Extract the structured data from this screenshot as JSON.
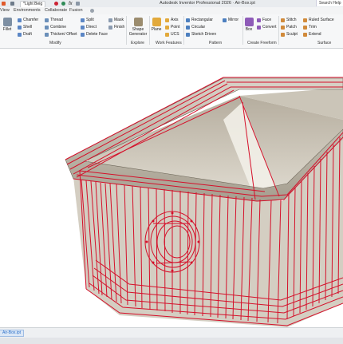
{
  "app": {
    "title": "Autodesk Inventor Professional 2026 · Air-Box.ipt",
    "search_label": "Search Help"
  },
  "quick_access": {
    "document_style": "*Light Beig",
    "fx_label": "fx"
  },
  "menu": {
    "tabs": [
      "View",
      "Environments",
      "Collaborate",
      "Fusion"
    ]
  },
  "ribbon": {
    "modify": {
      "label": "Modify",
      "fillet": "Fillet",
      "chamfer": "Chamfer",
      "shell": "Shell",
      "draft": "Draft",
      "thread": "Thread",
      "combine": "Combine",
      "thicken": "Thicken/ Offset",
      "split": "Split",
      "direct": "Direct",
      "delete_face": "Delete Face",
      "mask": "Mask",
      "finish": "Finish"
    },
    "explore": {
      "label": "Explore",
      "shape_generator": "Shape Generator"
    },
    "work_features": {
      "label": "Work Features",
      "plane": "Plane",
      "axis": "Axis",
      "point": "Point",
      "ucs": "UCS"
    },
    "pattern": {
      "label": "Pattern",
      "rectangular": "Rectangular",
      "circular": "Circular",
      "sketch_driven": "Sketch Driven",
      "mirror": "Mirror"
    },
    "create_freeform": {
      "label": "Create Freeform",
      "box": "Box",
      "face": "Face",
      "convert": "Convert"
    },
    "surface": {
      "label": "Surface",
      "stitch": "Stitch",
      "patch": "Patch",
      "sculpt": "Sculpt",
      "ruled_surface": "Ruled Surface",
      "trim": "Trim",
      "extend": "Extend"
    }
  },
  "status": {
    "tab_label": "Air-Box.ipt"
  },
  "colors": {
    "wire": "#d5102a",
    "accent": "#2a6fc9"
  }
}
